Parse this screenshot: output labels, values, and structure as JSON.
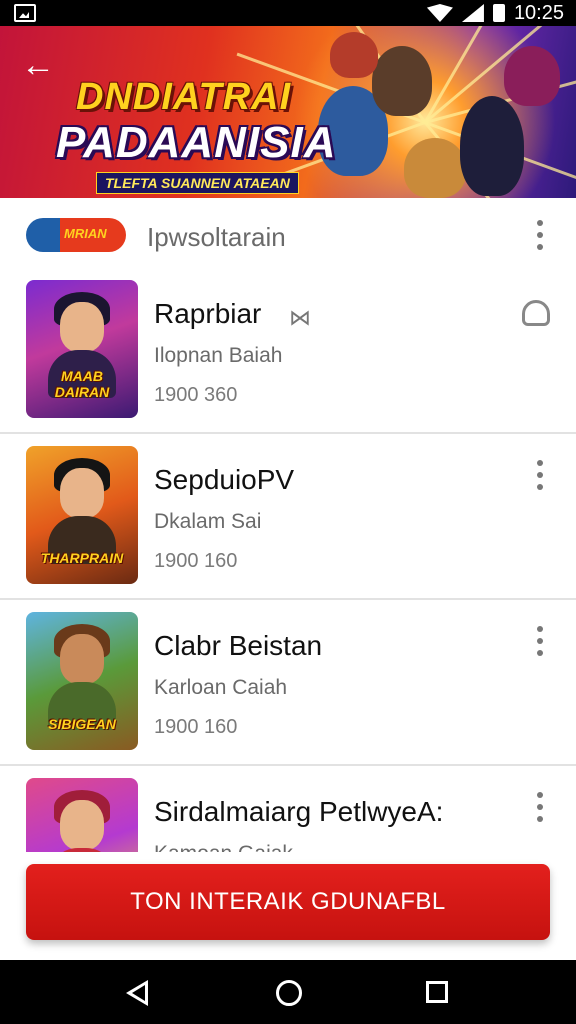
{
  "status_bar": {
    "time": "10:25"
  },
  "banner": {
    "title_line1": "DNDIATRAI",
    "title_line2": "PADAANISIA",
    "subtitle": "TLEFTA SUANNEN ATAEAN"
  },
  "header": {
    "title": "Ipwsoltarain",
    "thumb_logo": "MRIAN"
  },
  "games": [
    {
      "name": "Raprbiar",
      "sub": "Ilopnan Baiah",
      "stats": "1900 360",
      "thumb_logo": "MAAB DAIRAN",
      "theme": "purple"
    },
    {
      "name": "SepduiоPV",
      "sub": "Dkalam Sai",
      "stats": "1900 160",
      "thumb_logo": "THARPRAIN",
      "theme": "orange"
    },
    {
      "name": "Clabr Beistan",
      "sub": "Karloan Caiah",
      "stats": "1900 160",
      "thumb_logo": "SIBIGEAN",
      "theme": "green"
    },
    {
      "name": "Sirdalmaiarg PetlwyeA:",
      "sub": "Kamoan Gaiak",
      "stats": "",
      "thumb_logo": "",
      "theme": "pink"
    }
  ],
  "cta": {
    "label": "TON INTERAIK GDUNAFBL"
  },
  "colors": {
    "accent": "#d4161a",
    "banner_orange": "#f26b1c",
    "banner_purple": "#7a2bb8"
  },
  "icons": {
    "back": "arrow-left-icon",
    "more": "more-vertical-icon",
    "tag": "bow-tie-icon",
    "headset": "headset-icon"
  }
}
